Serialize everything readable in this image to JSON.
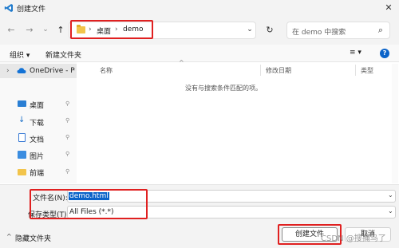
{
  "window": {
    "title": "创建文件",
    "close_glyph": "✕"
  },
  "nav": {
    "back_glyph": "←",
    "forward_glyph": "→",
    "history_glyph": "⌄",
    "up_glyph": "↑",
    "breadcrumb": [
      "桌面",
      "demo"
    ],
    "crumb_sep": "›",
    "address_dropdown_glyph": "⌄",
    "refresh_glyph": "↻",
    "search_placeholder": "在 demo 中搜索",
    "search_glyph": "⌕"
  },
  "toolbar": {
    "organize_label": "组织 ▾",
    "new_folder_label": "新建文件夹",
    "view_glyph": "≡ ▾",
    "help_glyph": "?"
  },
  "sidebar": {
    "onedrive_label": "OneDrive - Per",
    "items": [
      {
        "label": "桌面",
        "icon": "desktop-icon"
      },
      {
        "label": "下载",
        "icon": "download-icon"
      },
      {
        "label": "文档",
        "icon": "document-icon"
      },
      {
        "label": "图片",
        "icon": "pictures-icon"
      },
      {
        "label": "前端",
        "icon": "folder-icon"
      }
    ],
    "pin_glyph": "📌"
  },
  "file_list": {
    "columns": [
      "名称",
      "修改日期",
      "类型"
    ],
    "empty_message": "没有与搜索条件匹配的项。",
    "sort_glyph": "^"
  },
  "form": {
    "filename_label": "文件名(N):",
    "filename_value": "demo.html",
    "filetype_label": "保存类型(T):",
    "filetype_value": "All Files (*.*)"
  },
  "footer": {
    "hide_folders_label": "隐藏文件夹",
    "create_button": "创建文件",
    "cancel_button": "取消"
  },
  "watermark": "CSDN @搜捕鸟了",
  "colors": {
    "highlight_box": "#e02020",
    "selection": "#0a63c9",
    "vscode_blue": "#1f7acc"
  }
}
